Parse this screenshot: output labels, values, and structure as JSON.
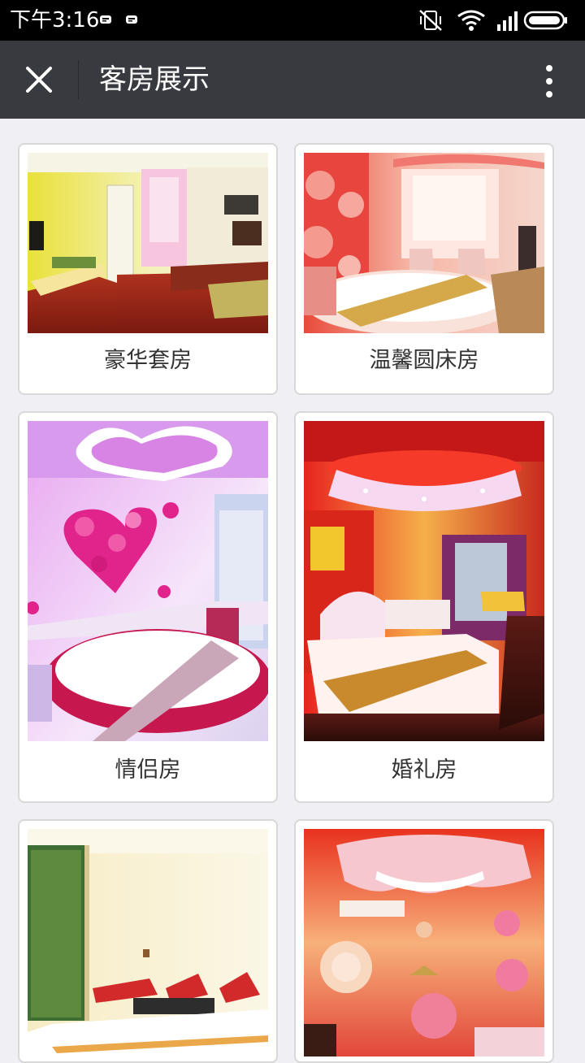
{
  "status_bar": {
    "time": "下午3:16"
  },
  "header": {
    "title": "客房展示"
  },
  "rooms": [
    {
      "name": "豪华套房"
    },
    {
      "name": "温馨圆床房"
    },
    {
      "name": "情侣房"
    },
    {
      "name": "婚礼房"
    },
    {
      "name": ""
    },
    {
      "name": ""
    }
  ],
  "colors": {
    "status_bar_bg": "#000000",
    "title_bar_bg": "#393a3f",
    "page_bg": "#efeff4",
    "card_border": "#d8d8d8"
  },
  "icons": {
    "close": "close-icon",
    "more": "more-vertical-icon",
    "mute": "vibrate-off-icon",
    "wifi": "wifi-icon",
    "signal": "signal-icon",
    "battery": "battery-icon"
  }
}
